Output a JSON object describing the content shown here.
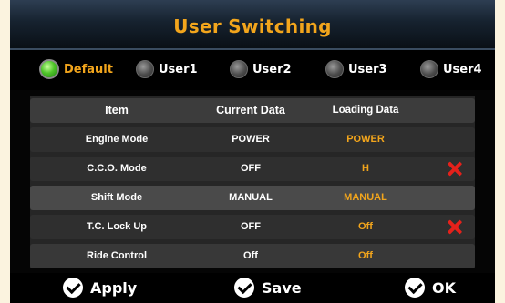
{
  "title": "User Switching",
  "users": [
    {
      "label": "Default",
      "selected": true
    },
    {
      "label": "User1",
      "selected": false
    },
    {
      "label": "User2",
      "selected": false
    },
    {
      "label": "User3",
      "selected": false
    },
    {
      "label": "User4",
      "selected": false
    }
  ],
  "table": {
    "headers": [
      "Item",
      "Current Data",
      "Loading Data"
    ],
    "rows": [
      {
        "item": "Engine Mode",
        "current": "POWER",
        "loading": "POWER",
        "mismatch": false
      },
      {
        "item": "C.C.O. Mode",
        "current": "OFF",
        "loading": "H",
        "mismatch": true
      },
      {
        "item": "Shift Mode",
        "current": "MANUAL",
        "loading": "MANUAL",
        "mismatch": false
      },
      {
        "item": "T.C. Lock Up",
        "current": "OFF",
        "loading": "Off",
        "mismatch": true
      },
      {
        "item": "Ride Control",
        "current": "Off",
        "loading": "Off",
        "mismatch": false
      }
    ]
  },
  "buttons": {
    "apply": "Apply",
    "save": "Save",
    "ok": "OK"
  },
  "colors": {
    "accent": "#f2a51c",
    "selected_radio": "#4fc62a",
    "mismatch_mark": "#e5211b"
  }
}
